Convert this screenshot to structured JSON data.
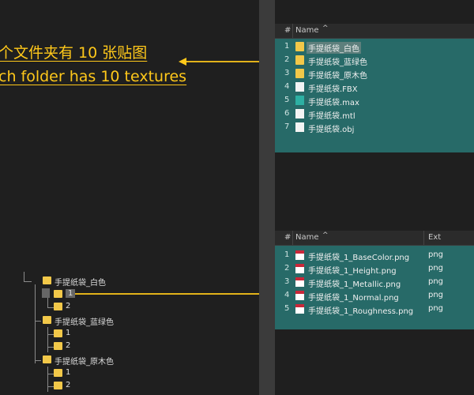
{
  "annotation": {
    "line_cn": "个文件夹有 10 张贴图",
    "line_en": "ch folder has 10 textures",
    "color": "#ffc81a"
  },
  "top_list": {
    "headers": {
      "hash": "#",
      "name": "Name"
    },
    "rows": [
      {
        "num": "1",
        "name": "手提纸袋_白色",
        "icon": "folder-icon"
      },
      {
        "num": "2",
        "name": "手提纸袋_蓝绿色",
        "icon": "folder-icon"
      },
      {
        "num": "3",
        "name": "手提纸袋_原木色",
        "icon": "folder-icon"
      },
      {
        "num": "4",
        "name": "手提纸袋.FBX",
        "icon": "file-icon"
      },
      {
        "num": "5",
        "name": "手提纸袋.max",
        "icon": "max-file-icon"
      },
      {
        "num": "6",
        "name": "手提纸袋.mtl",
        "icon": "mtl-file-icon"
      },
      {
        "num": "7",
        "name": "手提纸袋.obj",
        "icon": "obj-file-icon"
      }
    ]
  },
  "bottom_list": {
    "headers": {
      "hash": "#",
      "name": "Name",
      "ext": "Ext"
    },
    "rows": [
      {
        "num": "1",
        "name": "手提纸袋_1_BaseColor.png",
        "ext": "png"
      },
      {
        "num": "2",
        "name": "手提纸袋_1_Height.png",
        "ext": "png"
      },
      {
        "num": "3",
        "name": "手提纸袋_1_Metallic.png",
        "ext": "png"
      },
      {
        "num": "4",
        "name": "手提纸袋_1_Normal.png",
        "ext": "png"
      },
      {
        "num": "5",
        "name": "手提纸袋_1_Roughness.png",
        "ext": "png"
      }
    ]
  },
  "tree": {
    "nodes": [
      {
        "label": "手提纸袋_白色"
      },
      {
        "label": "1"
      },
      {
        "label": "2"
      },
      {
        "label": "手提纸袋_蓝绿色"
      },
      {
        "label": "1"
      },
      {
        "label": "2"
      },
      {
        "label": "手提纸袋_原木色"
      },
      {
        "label": "1"
      },
      {
        "label": "2"
      }
    ]
  },
  "colors": {
    "panel_bg": "#1f1f1f",
    "selection": "#276a68",
    "accent": "#ffc81a"
  }
}
